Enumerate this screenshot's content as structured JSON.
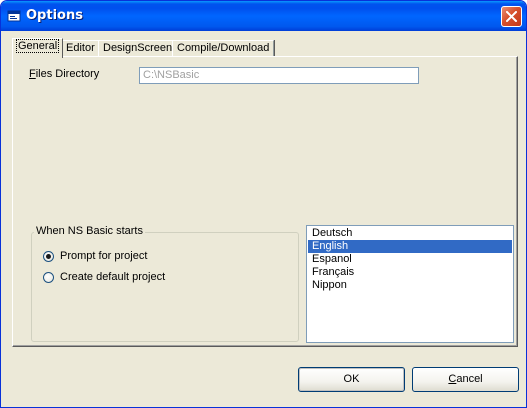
{
  "window": {
    "title": "Options"
  },
  "tabs": [
    {
      "label": "General",
      "active": true
    },
    {
      "label": "Editor",
      "active": false
    },
    {
      "label": "DesignScreen",
      "active": false
    },
    {
      "label": "Compile/Download",
      "active": false
    }
  ],
  "general": {
    "files_directory": {
      "label_first": "F",
      "label_rest": "iles Directory",
      "value": "C:\\NSBasic"
    },
    "startup_group": {
      "title": "When NS Basic starts",
      "options": [
        {
          "label": "Prompt for project",
          "checked": true
        },
        {
          "label": "Create default project",
          "checked": false
        }
      ]
    },
    "languages": {
      "items": [
        "Deutsch",
        "English",
        "Espanol",
        "Français",
        "Nippon"
      ],
      "selected": "English"
    }
  },
  "buttons": {
    "ok_label": "OK",
    "cancel_first": "C",
    "cancel_rest": "ancel"
  },
  "colors": {
    "selection": "#316ac5",
    "titlebar": "#0058ee",
    "dialog_face": "#ece9d8"
  }
}
